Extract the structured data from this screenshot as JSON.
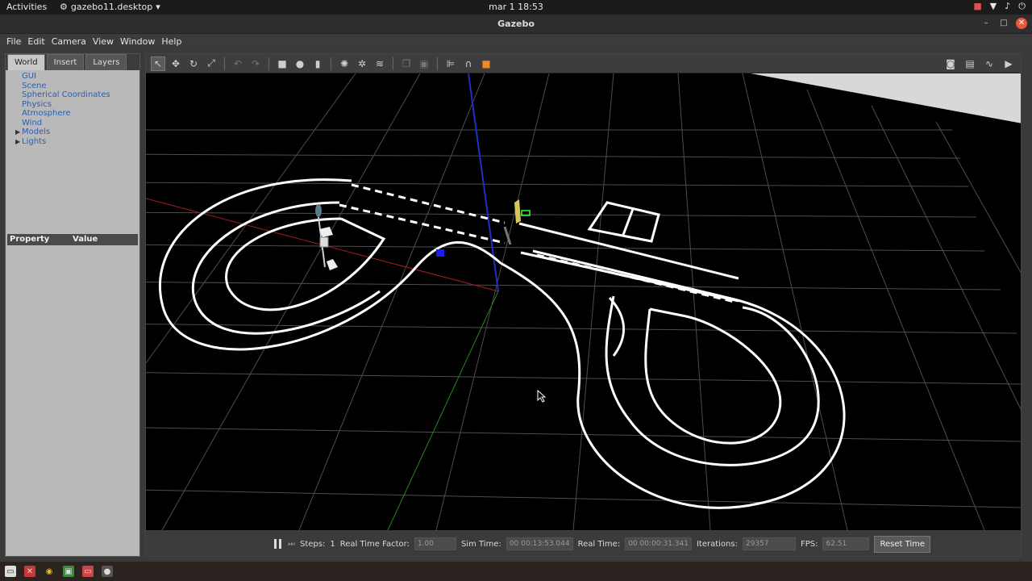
{
  "topbar": {
    "activities": "Activities",
    "app": "gazebo11.desktop",
    "clock": "mar 1  18:53",
    "tray_icons": [
      "camera-icon",
      "wifi-icon",
      "volume-icon",
      "power-icon"
    ]
  },
  "window": {
    "title": "Gazebo"
  },
  "menu": [
    "File",
    "Edit",
    "Camera",
    "View",
    "Window",
    "Help"
  ],
  "left_panel": {
    "tabs": [
      "World",
      "Insert",
      "Layers"
    ],
    "active_tab": "World",
    "tree": [
      {
        "label": "GUI",
        "expandable": false
      },
      {
        "label": "Scene",
        "expandable": false
      },
      {
        "label": "Spherical Coordinates",
        "expandable": false
      },
      {
        "label": "Physics",
        "expandable": false
      },
      {
        "label": "Atmosphere",
        "expandable": false
      },
      {
        "label": "Wind",
        "expandable": false
      },
      {
        "label": "Models",
        "expandable": true
      },
      {
        "label": "Lights",
        "expandable": true
      }
    ],
    "property_header": {
      "property": "Property",
      "value": "Value"
    }
  },
  "status": {
    "steps_label": "Steps:",
    "steps_value": "1",
    "rtf_label": "Real Time Factor:",
    "rtf_value": "1.00",
    "sim_label": "Sim Time:",
    "sim_value": "00 00:13:53.044",
    "real_label": "Real Time:",
    "real_value": "00 00:00:31.341",
    "iter_label": "Iterations:",
    "iter_value": "29357",
    "fps_label": "FPS:",
    "fps_value": "62.51",
    "reset_label": "Reset Time"
  },
  "colors": {
    "viewport_bg": "#000000",
    "grid": "#5a5a5a",
    "track": "#ffffff",
    "accent_close": "#e9573f"
  }
}
